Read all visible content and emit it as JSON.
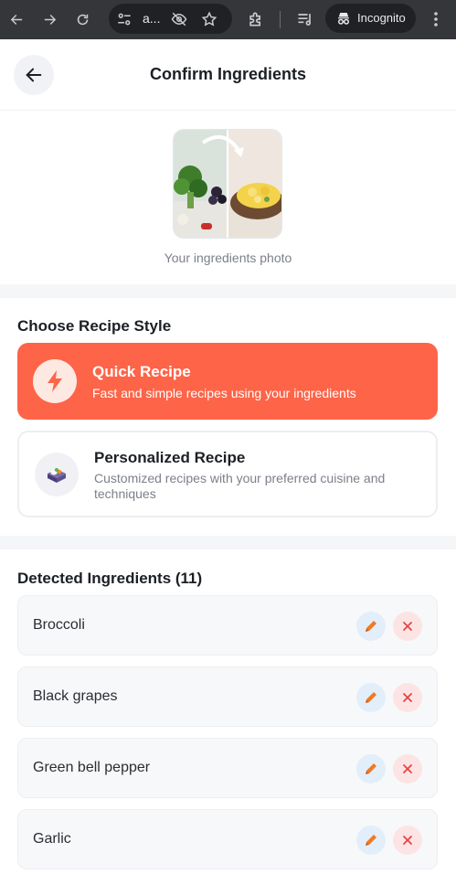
{
  "browser": {
    "url_text": "a...",
    "incognito_label": "Incognito"
  },
  "header": {
    "title": "Confirm Ingredients"
  },
  "photo": {
    "caption": "Your ingredients photo"
  },
  "recipe_style": {
    "title": "Choose Recipe Style",
    "options": [
      {
        "title": "Quick Recipe",
        "description": "Fast and simple recipes using your ingredients",
        "selected": true
      },
      {
        "title": "Personalized Recipe",
        "description": "Customized recipes with your preferred cuisine and techniques",
        "selected": false
      }
    ]
  },
  "ingredients": {
    "title": "Detected Ingredients (11)",
    "items": [
      {
        "name": "Broccoli"
      },
      {
        "name": "Black grapes"
      },
      {
        "name": "Green bell pepper"
      },
      {
        "name": "Garlic"
      }
    ]
  },
  "colors": {
    "accent": "#fd6448",
    "edit_icon": "#f07a22",
    "delete_icon": "#e64545"
  }
}
